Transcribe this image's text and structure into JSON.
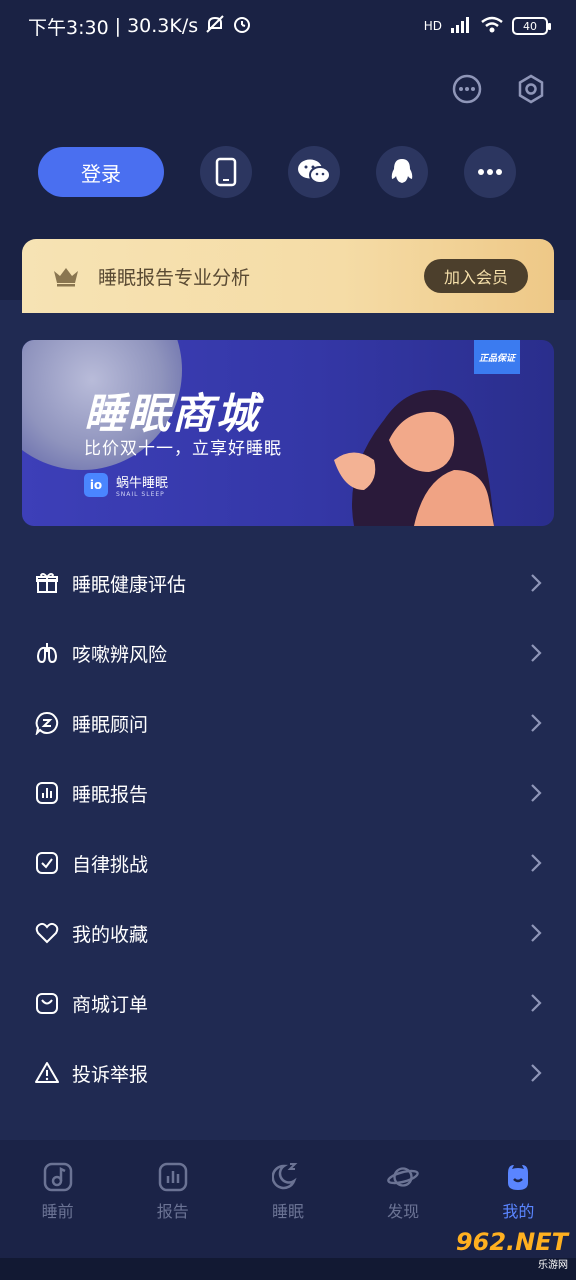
{
  "status_bar": {
    "time": "下午3:30",
    "separator": "|",
    "speed": "30.3K/s",
    "network": "HD",
    "battery": "40"
  },
  "header": {
    "message_icon": "chat-bubble-icon",
    "settings_icon": "hexagon-settings-icon"
  },
  "login": {
    "button_label": "登录",
    "share_options": [
      "tablet-icon",
      "wechat-icon",
      "qq-icon",
      "more-icon"
    ]
  },
  "vip": {
    "text": "睡眠报告专业分析",
    "join_label": "加入会员"
  },
  "banner": {
    "badge": "正品保证",
    "title": "睡眠商城",
    "subtitle": "比价双十一，立享好睡眠",
    "logo_mark": "io",
    "logo_text": "蜗牛睡眠",
    "logo_en": "SNAIL SLEEP"
  },
  "menu": {
    "items": [
      {
        "label": "睡眠健康评估",
        "icon": "gift-icon"
      },
      {
        "label": "咳嗽辨风险",
        "icon": "lungs-icon"
      },
      {
        "label": "睡眠顾问",
        "icon": "advisor-chat-icon"
      },
      {
        "label": "睡眠报告",
        "icon": "report-chart-icon"
      },
      {
        "label": "自律挑战",
        "icon": "check-square-icon"
      },
      {
        "label": "我的收藏",
        "icon": "heart-icon"
      },
      {
        "label": "商城订单",
        "icon": "shopping-bag-icon"
      },
      {
        "label": "投诉举报",
        "icon": "warning-icon"
      }
    ]
  },
  "tabs": [
    {
      "label": "睡前",
      "icon": "music-note-icon"
    },
    {
      "label": "报告",
      "icon": "bar-chart-icon"
    },
    {
      "label": "睡眠",
      "icon": "moon-icon"
    },
    {
      "label": "发现",
      "icon": "planet-icon"
    },
    {
      "label": "我的",
      "icon": "profile-icon",
      "active": true
    }
  ],
  "watermark": {
    "main": "962.NET",
    "sub": "乐游网"
  },
  "colors": {
    "background": "#1b2448",
    "accent": "#4a6ff0",
    "vip_gold": "#f5dca6",
    "tab_active": "#5a85ff"
  }
}
